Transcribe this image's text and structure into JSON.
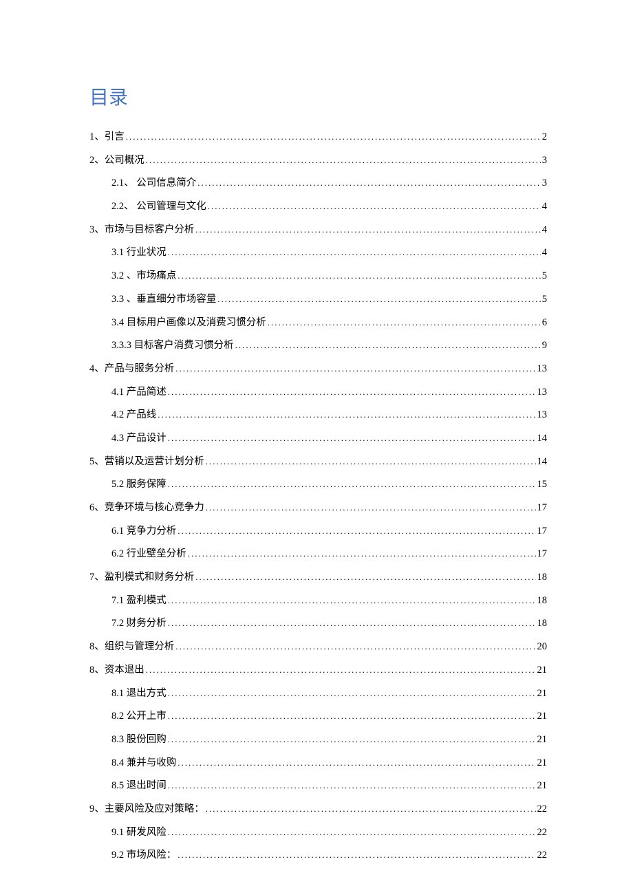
{
  "title": "目录",
  "entries": [
    {
      "level": 1,
      "label": "1、引言",
      "page": "2"
    },
    {
      "level": 1,
      "label": "2、公司概况",
      "page": "3"
    },
    {
      "level": 2,
      "label": "2.1、 公司信息简介",
      "page": "3"
    },
    {
      "level": 2,
      "label": "2.2、 公司管理与文化",
      "page": "4"
    },
    {
      "level": 1,
      "label": "3、市场与目标客户分析",
      "page": "4"
    },
    {
      "level": 2,
      "label": "3.1   行业状况",
      "page": "4"
    },
    {
      "level": 2,
      "label": "3.2   、市场痛点",
      "page": "5"
    },
    {
      "level": 2,
      "label": "3.3   、垂直细分市场容量",
      "page": "5"
    },
    {
      "level": 2,
      "label": "3.4   目标用户画像以及消费习惯分析",
      "page": "6"
    },
    {
      "level": 2,
      "label": "3.3.3 目标客户消费习惯分析",
      "page": "9"
    },
    {
      "level": 1,
      "label": "4、产品与服务分析",
      "page": "13"
    },
    {
      "level": 2,
      "label": "4.1   产品简述",
      "page": "13"
    },
    {
      "level": 2,
      "label": "4.2   产品线",
      "page": "13"
    },
    {
      "level": 2,
      "label": "4.3   产品设计",
      "page": "14"
    },
    {
      "level": 1,
      "label": "5、营销以及运营计划分析",
      "page": "14"
    },
    {
      "level": 2,
      "label": "5.2   服务保障",
      "page": "15"
    },
    {
      "level": 1,
      "label": "6、竞争环境与核心竞争力",
      "page": "17"
    },
    {
      "level": 2,
      "label": "6.1   竞争力分析",
      "page": "17"
    },
    {
      "level": 2,
      "label": "6.2   行业壁垒分析",
      "page": "17"
    },
    {
      "level": 1,
      "label": "7、盈利模式和财务分析",
      "page": "18"
    },
    {
      "level": 2,
      "label": "7.1   盈利模式",
      "page": "18"
    },
    {
      "level": 2,
      "label": "7.2   财务分析",
      "page": "18"
    },
    {
      "level": 1,
      "label": "8、组织与管理分析",
      "page": "20"
    },
    {
      "level": 1,
      "label": "8、资本退出",
      "page": "21"
    },
    {
      "level": 2,
      "label": "8.1   退出方式",
      "page": "21"
    },
    {
      "level": 2,
      "label": "8.2   公开上市",
      "page": "21"
    },
    {
      "level": 2,
      "label": "8.3   股份回购",
      "page": "21"
    },
    {
      "level": 2,
      "label": "8.4   兼并与收购",
      "page": "21"
    },
    {
      "level": 2,
      "label": "8.5   退出时间",
      "page": "21"
    },
    {
      "level": 1,
      "label": "9、主要风险及应对策略：",
      "page": "22"
    },
    {
      "level": 2,
      "label": "9.1   研发风险",
      "page": "22"
    },
    {
      "level": 2,
      "label": "9.2   市场风险：",
      "page": "22"
    }
  ]
}
